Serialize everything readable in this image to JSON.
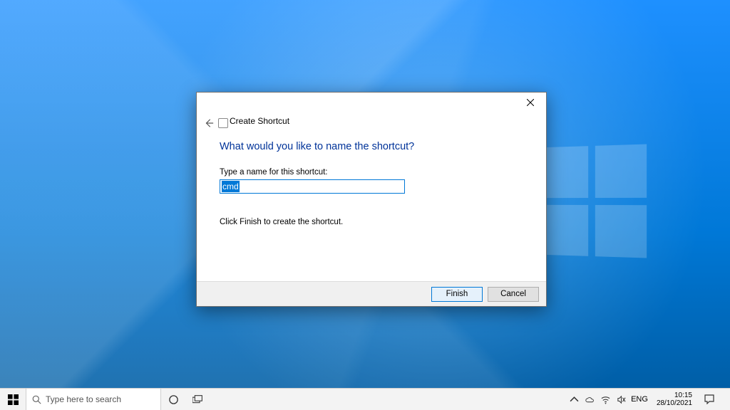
{
  "dialog": {
    "title": "Create Shortcut",
    "heading": "What would you like to name the shortcut?",
    "name_label": "Type a name for this shortcut:",
    "name_value": "cmd",
    "hint": "Click Finish to create the shortcut.",
    "finish_label": "Finish",
    "cancel_label": "Cancel"
  },
  "taskbar": {
    "search_placeholder": "Type here to search",
    "lang": "ENG",
    "time": "10:15",
    "date": "28/10/2021"
  }
}
